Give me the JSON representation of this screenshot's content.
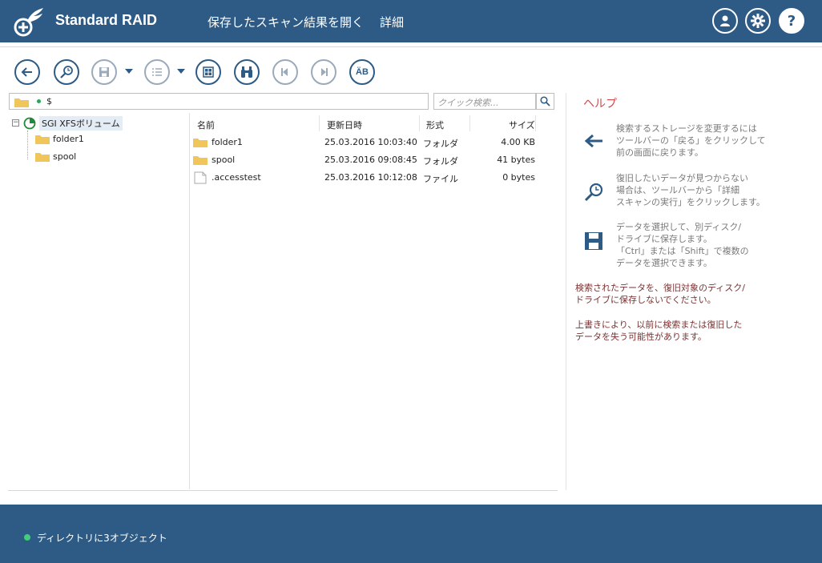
{
  "header": {
    "app_title": "Standard RAID",
    "menu": [
      "保存したスキャン結果を開く",
      "詳細"
    ],
    "help_button": "?"
  },
  "toolbar": {
    "sort_label": "ÄB"
  },
  "pathbar": {
    "path": "$"
  },
  "search": {
    "placeholder": "クイック検索..."
  },
  "tree": {
    "root": "SGI XFSボリューム",
    "children": [
      "folder1",
      "spool"
    ]
  },
  "list": {
    "columns": [
      "名前",
      "更新日時",
      "形式",
      "サイズ"
    ],
    "rows": [
      {
        "name": "folder1",
        "date": "25.03.2016 10:03:40",
        "type": "フォルダ",
        "size": "4.00 KB",
        "icon": "folder-icon"
      },
      {
        "name": "spool",
        "date": "25.03.2016 09:08:45",
        "type": "フォルダ",
        "size": "41 bytes",
        "icon": "folder-icon"
      },
      {
        "name": ".accesstest",
        "date": "25.03.2016 10:12:08",
        "type": "ファイル",
        "size": "0 bytes",
        "icon": "file-icon"
      }
    ]
  },
  "help": {
    "title": "ヘルプ",
    "items": [
      {
        "icon": "back-arrow-icon",
        "lines": [
          "検索するストレージを変更するには",
          "ツールバーの「戻る」をクリックして",
          "前の画面に戻ります。"
        ]
      },
      {
        "icon": "magnify-icon",
        "lines": [
          "復旧したいデータが見つからない",
          "場合は、ツールバーから「詳細",
          "スキャンの実行」をクリックします。"
        ]
      },
      {
        "icon": "save-icon",
        "lines": [
          "データを選択して、別ディスク/",
          "ドライブに保存します。",
          "「Ctrl」または「Shift」で複数の",
          "データを選択できます。"
        ]
      }
    ],
    "warnings": [
      [
        "検索されたデータを、復旧対象のディスク/",
        "ドライブに保存しないでください。"
      ],
      [
        "上書きにより、以前に検索または復旧した",
        "データを失う可能性があります。"
      ]
    ]
  },
  "footer": {
    "status": "ディレクトリに3オブジェクト"
  },
  "colors": {
    "brand": "#2d5b85",
    "help_title": "#d04a4a",
    "status_dot": "#3fcf7a"
  }
}
